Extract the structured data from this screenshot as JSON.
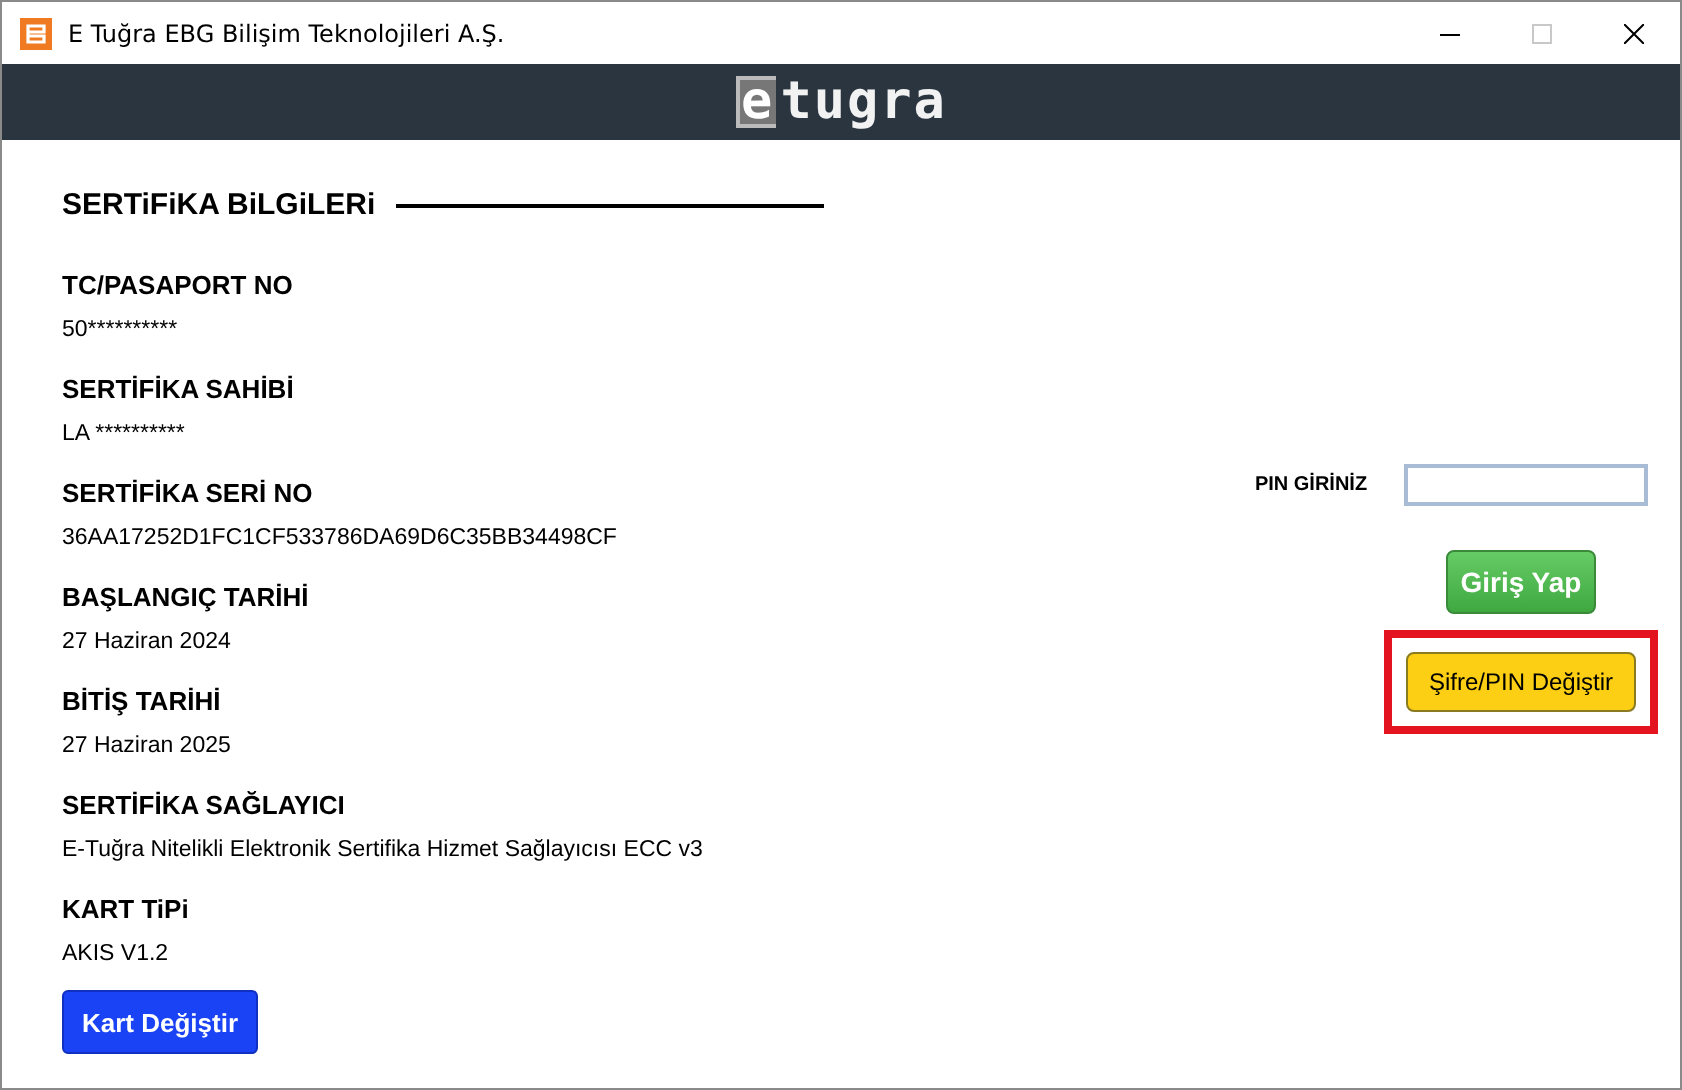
{
  "window": {
    "title": "E Tuğra EBG Bilişim Teknolojileri A.Ş."
  },
  "header": {
    "logo": "etugra"
  },
  "certificate": {
    "heading": "SERTiFiKA BiLGiLERi",
    "fields": [
      {
        "label": "TC/PASAPORT NO",
        "value": "50**********"
      },
      {
        "label": "SERTİFİKA SAHİBİ",
        "value": "LA **********"
      },
      {
        "label": "SERTİFİKA SERİ NO",
        "value": "36AA17252D1FC1CF533786DA69D6C35BB34498CF"
      },
      {
        "label": "BAŞLANGIÇ TARİHİ",
        "value": "27 Haziran 2024"
      },
      {
        "label": "BİTİŞ TARİHİ",
        "value": "27 Haziran 2025"
      },
      {
        "label": "SERTİFİKA SAĞLAYICI",
        "value": "E-Tuğra Nitelikli Elektronik Sertifika Hizmet Sağlayıcısı ECC v3"
      },
      {
        "label": "KART TiPi",
        "value": "AKIS V1.2"
      }
    ],
    "button": "Kart Değiştir"
  },
  "login": {
    "pin_label": "PIN GİRİNİZ",
    "pin_focused": true,
    "login_button": "Giriş Yap",
    "change_button": {
      "label": "Şifre/PIN Değiştir",
      "highlighted": true
    }
  }
}
